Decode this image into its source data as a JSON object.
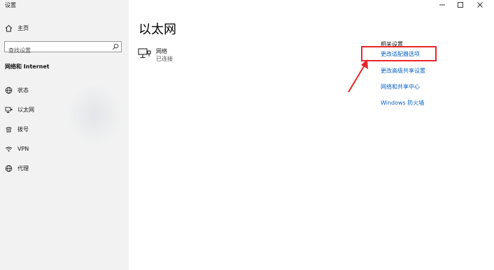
{
  "window": {
    "title": "设置"
  },
  "sidebar": {
    "home_label": "主页",
    "search_placeholder": "查找设置",
    "search_value": "",
    "section_title": "网络和 Internet",
    "items": [
      {
        "label": "状态",
        "icon": "status-globe-icon"
      },
      {
        "label": "以太网",
        "icon": "ethernet-icon"
      },
      {
        "label": "拨号",
        "icon": "dialup-icon"
      },
      {
        "label": "VPN",
        "icon": "vpn-icon"
      },
      {
        "label": "代理",
        "icon": "proxy-globe-icon"
      }
    ]
  },
  "main": {
    "title": "以太网",
    "network": {
      "name": "网络",
      "status": "已连接",
      "icon": "ethernet-network-icon"
    }
  },
  "related": {
    "heading": "相关设置",
    "links": [
      "更改适配器选项",
      "更改高级共享设置",
      "网络和共享中心",
      "Windows 防火墙"
    ]
  },
  "colors": {
    "link": "#0b63c4",
    "annotation": "#e8262a",
    "sidebar_bg": "#f2f2f2"
  }
}
